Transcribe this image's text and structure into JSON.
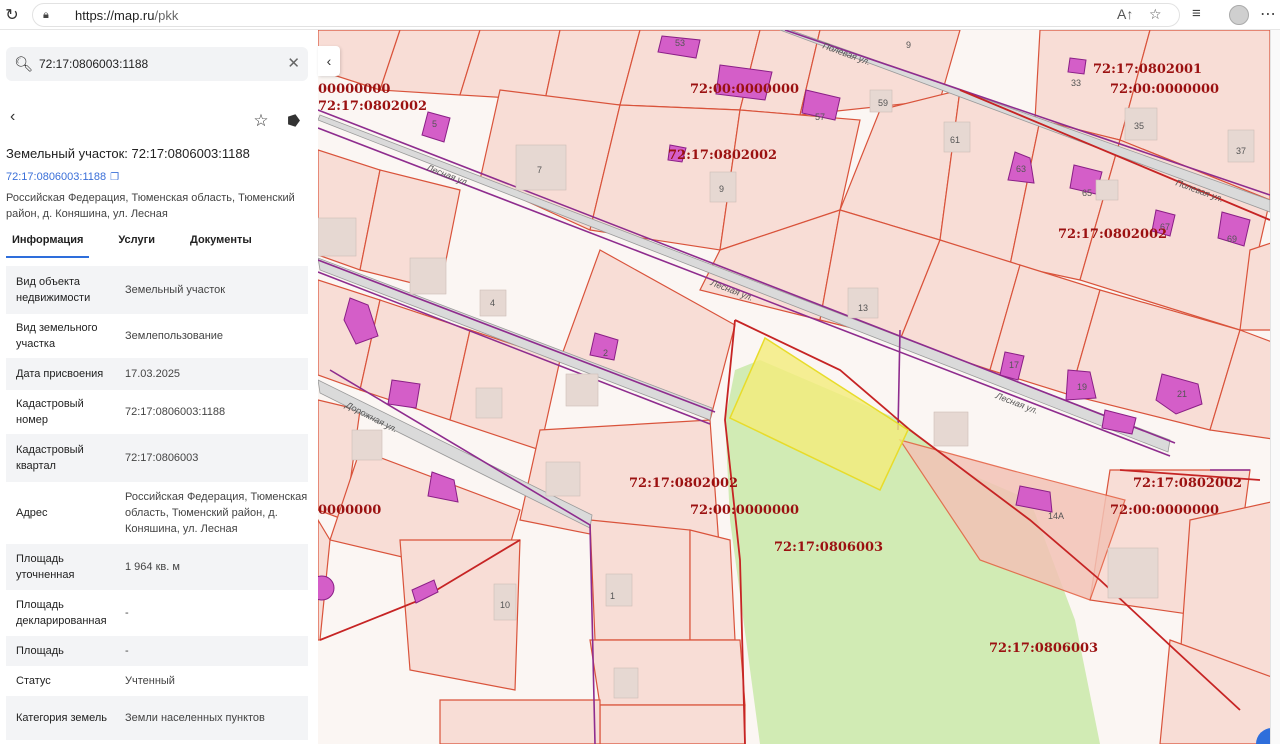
{
  "browser": {
    "url_host": "https://map.ru",
    "url_path": "/pkk"
  },
  "search": {
    "value": "72:17:0806003:1188"
  },
  "object": {
    "title": "Земельный участок: 72:17:0806003:1188",
    "link": "72:17:0806003:1188",
    "address": "Российская Федерация, Тюменская область, Тюменский район, д. Коняшина, ул. Лесная"
  },
  "tabs": [
    {
      "label": "Информация"
    },
    {
      "label": "Услуги"
    },
    {
      "label": "Документы"
    }
  ],
  "properties": [
    {
      "key": "Вид объекта недвижимости",
      "value": "Земельный участок"
    },
    {
      "key": "Вид земельного участка",
      "value": "Землепользование"
    },
    {
      "key": "Дата присвоения",
      "value": "17.03.2025"
    },
    {
      "key": "Кадастровый номер",
      "value": "72:17:0806003:1188"
    },
    {
      "key": "Кадастровый квартал",
      "value": "72:17:0806003"
    },
    {
      "key": "Адрес",
      "value": "Российская Федерация, Тюменская область, Тюменский район, д. Коняшина, ул. Лесная"
    },
    {
      "key": "Площадь уточненная",
      "value": "1 964 кв. м"
    },
    {
      "key": "Площадь декларированная",
      "value": "-"
    },
    {
      "key": "Площадь",
      "value": "-"
    },
    {
      "key": "Статус",
      "value": "Учтенный"
    },
    {
      "key": "Категория земель",
      "value": "Земли населенных пунктов"
    }
  ],
  "map": {
    "quarter_labels": {
      "q1": "00000000",
      "q2": "72:17:0802002",
      "q3": "72:00:0000000",
      "q4": "72:17:0802002",
      "q5": "72:17:0802001",
      "q6": "72:00:0000000",
      "q7": "72:17:0802002",
      "q8": "72:17:0802002",
      "q9": "72:00:0000000",
      "q10": "72:17:0806003",
      "q11": "0000000",
      "q12": "72:17:0802002",
      "q13": "72:00:0000000",
      "q14": "72:17:0806003"
    },
    "house_numbers": [
      "53",
      "9",
      "33",
      "35",
      "37",
      "5",
      "7",
      "9",
      "59",
      "57",
      "61",
      "63",
      "65",
      "67",
      "69",
      "4",
      "2",
      "13",
      "17",
      "19",
      "21",
      "14А",
      "1",
      "10"
    ],
    "streets": [
      "Лесная ул.",
      "Лесная ул.",
      "Полевая ул.",
      "Полевая ул.",
      "Лесная ул.",
      "Дорожная ул."
    ]
  }
}
